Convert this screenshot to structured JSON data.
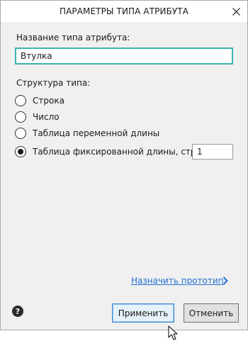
{
  "dialog": {
    "title": "ПАРАМЕТРЫ ТИПА АТРИБУТА",
    "close_icon": "close-icon"
  },
  "name_field": {
    "label": "Название типа атрибута:",
    "value": "Втулка"
  },
  "structure": {
    "label": "Структура типа:",
    "options": [
      {
        "label": "Строка",
        "checked": false
      },
      {
        "label": "Число",
        "checked": false
      },
      {
        "label": "Таблица переменной длины",
        "checked": false
      },
      {
        "label": "Таблица фиксированной длины, строк",
        "checked": true
      }
    ],
    "rows_value": "1"
  },
  "prototype_link": {
    "label": "Назначить прототип",
    "icon": "chevron-right-icon",
    "color": "#1f6fcf"
  },
  "footer": {
    "help_icon": "help-icon",
    "help_glyph": "?",
    "apply_label": "Применить",
    "cancel_label": "Отменить"
  },
  "colors": {
    "input_focus_border": "#3fb2b2",
    "content_background": "#f0f0f0"
  }
}
